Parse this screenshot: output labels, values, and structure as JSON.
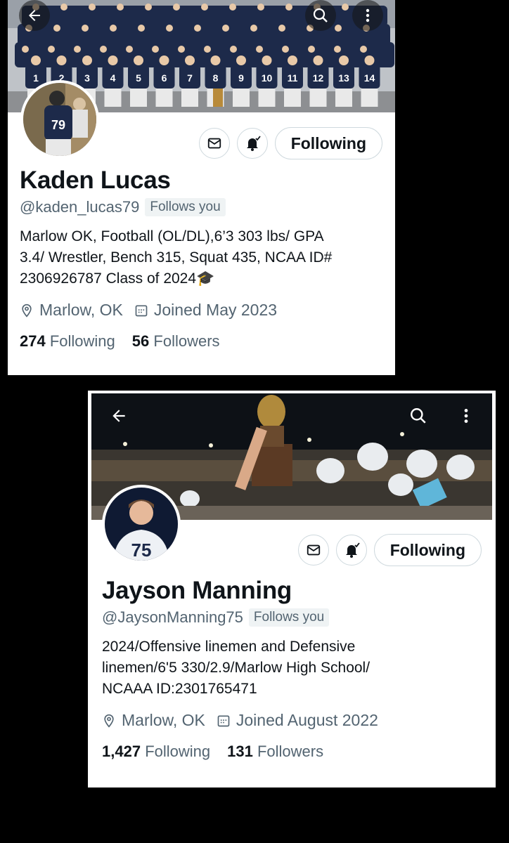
{
  "profiles": [
    {
      "name": "Kaden Lucas",
      "handle": "@kaden_lucas79",
      "follows_you": "Follows you",
      "bio": "Marlow OK, Football (OL/DL),6’3 303 lbs/ GPA\n3.4/ Wrestler, Bench 315, Squat 435,  NCAA ID#\n2306926787 Class of 2024🎓",
      "location": "Marlow, OK",
      "joined": "Joined May 2023",
      "following_count": "274",
      "following_label": "Following",
      "followers_count": "56",
      "followers_label": "Followers",
      "follow_button": "Following",
      "avatar_jersey": "79",
      "icons": [
        "back-arrow-icon",
        "search-icon",
        "more-icon",
        "message-icon",
        "notification-bell-icon",
        "location-pin-icon",
        "calendar-icon"
      ]
    },
    {
      "name": "Jayson Manning",
      "handle": "@JaysonManning75",
      "follows_you": "Follows you",
      "bio": "2024/Offensive linemen and Defensive\nlinemen/6'5 330/2.9/Marlow High School/\nNCAAA ID:2301765471",
      "location": "Marlow, OK",
      "joined": "Joined August 2022",
      "following_count": "1,427",
      "following_label": "Following",
      "followers_count": "131",
      "followers_label": "Followers",
      "follow_button": "Following",
      "avatar_jersey": "75",
      "icons": [
        "back-arrow-icon",
        "search-icon",
        "more-icon",
        "message-icon",
        "notification-bell-icon",
        "location-pin-icon",
        "calendar-icon"
      ]
    }
  ],
  "banner1": {
    "jerseys": [
      "1",
      "2",
      "3",
      "4",
      "5",
      "6",
      "7",
      "8",
      "9",
      "10",
      "11",
      "12",
      "13",
      "14"
    ]
  },
  "colors": {
    "text": "#0f1419",
    "muted": "#536471",
    "border": "#cfd9de",
    "navy": "#1d2a4a"
  }
}
